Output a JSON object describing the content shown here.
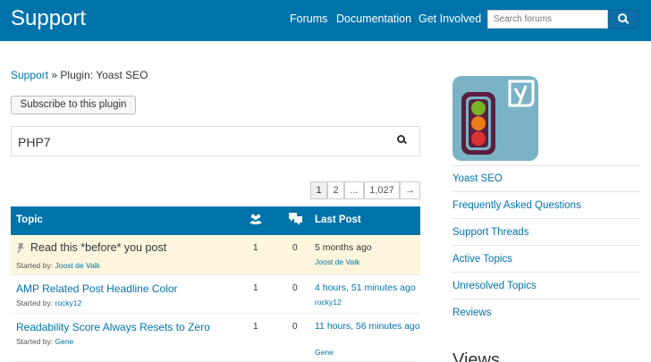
{
  "header": {
    "title": "Support",
    "nav": [
      "Forums",
      "Documentation",
      "Get Involved"
    ],
    "search_placeholder": "Search forums"
  },
  "breadcrumb": {
    "root": "Support",
    "sep": "»",
    "current": "Plugin: Yoast SEO"
  },
  "subscribe_label": "Subscribe to this plugin",
  "forum_search": {
    "value": "PHP7"
  },
  "pagination": {
    "pages": [
      "1",
      "2",
      "...",
      "1,027"
    ],
    "next": "→"
  },
  "table": {
    "headers": {
      "topic": "Topic",
      "last_post": "Last Post"
    },
    "rows": [
      {
        "title": "Read this *before* you post",
        "started_by": "Started by:",
        "author": "Joost de Valk",
        "voices": "1",
        "replies": "0",
        "last_post": "5 months ago",
        "last_by": "Joost de Valk",
        "sticky": true
      },
      {
        "title": "AMP Related Post Headline Color",
        "started_by": "Started by:",
        "author": "rocky12",
        "voices": "1",
        "replies": "0",
        "last_post": "4 hours, 51 minutes ago",
        "last_by": "rocky12",
        "sticky": false
      },
      {
        "title": "Readability Score Always Resets to Zero",
        "started_by": "Started by:",
        "author": "Gene",
        "voices": "1",
        "replies": "0",
        "last_post": "11 hours, 56 minutes ago",
        "last_by": "Gene",
        "sticky": false
      }
    ]
  },
  "sidebar": {
    "links": [
      "Yoast SEO",
      "Frequently Asked Questions",
      "Support Threads",
      "Active Topics",
      "Unresolved Topics",
      "Reviews"
    ],
    "views_heading": "Views"
  },
  "colors": {
    "brand": "#0073aa",
    "sticky_bg": "#fdf6dd",
    "logo_bg": "#7bb3c6"
  }
}
